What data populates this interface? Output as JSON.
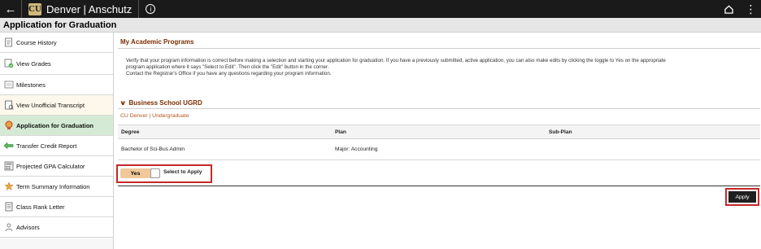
{
  "topbar": {
    "brand": "Denver | Anschutz",
    "logo_text": "CU",
    "back_icon": "back-arrow-icon",
    "info_icon": "info-icon",
    "home_icon": "home-icon",
    "more_icon": "more-menu-icon"
  },
  "page": {
    "title": "Application for Graduation"
  },
  "sidebar": {
    "items": [
      {
        "label": "Course History",
        "icon": "course-history-icon"
      },
      {
        "label": "View Grades",
        "icon": "grades-icon"
      },
      {
        "label": "Milestones",
        "icon": "milestones-icon"
      },
      {
        "label": "View Unofficial Transcript",
        "icon": "transcript-icon"
      },
      {
        "label": "Application for Graduation",
        "icon": "graduation-icon",
        "active": true
      },
      {
        "label": "Transfer Credit Report",
        "icon": "transfer-arrow-icon"
      },
      {
        "label": "Projected GPA Calculator",
        "icon": "calculator-icon"
      },
      {
        "label": "Term Summary Information",
        "icon": "term-summary-icon"
      },
      {
        "label": "Class Rank Letter",
        "icon": "letter-icon"
      },
      {
        "label": "Advisors",
        "icon": "advisors-icon"
      }
    ]
  },
  "main": {
    "section_title": "My Academic Programs",
    "instructions": [
      "Verify that your program information is correct before making a selection and starting your application for graduation. If you have a previously submitted, active application, you can also make edits by clicking the toggle to Yes on the appropriate",
      "program application where it says \"Select to Edit\". Then click the \"Edit\" button in the corner.",
      "Contact the Registrar's Office if you have any questions regarding your program information."
    ],
    "program": {
      "header": "Business School UGRD",
      "campus": "CU Denver | Undergraduate",
      "columns": [
        "Degree",
        "Plan",
        "Sub-Plan"
      ],
      "rows": [
        [
          "Bachelor of Sci-Bus Admin",
          "Major: Accounting",
          ""
        ]
      ]
    },
    "toggle": {
      "state_label": "Yes",
      "text": "Select to Apply"
    },
    "apply_label": "Apply"
  },
  "colors": {
    "topbar_bg": "#1a1a1a",
    "section_title": "#7a2d00",
    "campus_link": "#b3541e",
    "active_nav_bg": "#d4ead4",
    "toggle_bg": "#f0c89a",
    "highlight_border": "#c62828",
    "logo_gold": "#cfb87c"
  }
}
